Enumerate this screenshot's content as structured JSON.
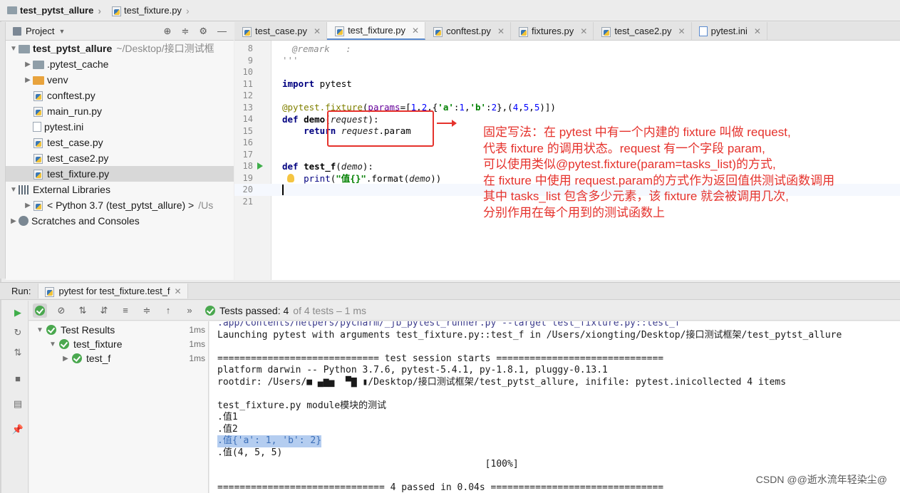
{
  "breadcrumb": {
    "project": "test_pytst_allure",
    "file": "test_fixture.py"
  },
  "project_panel": {
    "title": "Project",
    "tree": [
      {
        "label": "test_pytst_allure",
        "suffix": "~/Desktop/接口测试框",
        "icon": "folder-icon",
        "depth": 0,
        "expanded": true
      },
      {
        "label": ".pytest_cache",
        "icon": "folder-icon",
        "depth": 1,
        "expanded": false
      },
      {
        "label": "venv",
        "icon": "folder-orange-icon",
        "depth": 1,
        "expanded": false
      },
      {
        "label": "conftest.py",
        "icon": "python-file-icon",
        "depth": 1
      },
      {
        "label": "main_run.py",
        "icon": "python-file-icon",
        "depth": 1
      },
      {
        "label": "pytest.ini",
        "icon": "ini-file-icon",
        "depth": 1
      },
      {
        "label": "test_case.py",
        "icon": "python-file-icon",
        "depth": 1
      },
      {
        "label": "test_case2.py",
        "icon": "python-file-icon",
        "depth": 1
      },
      {
        "label": "test_fixture.py",
        "icon": "python-file-icon",
        "depth": 1,
        "selected": true
      },
      {
        "label": "External Libraries",
        "icon": "library-icon",
        "depth": 0,
        "expanded": true
      },
      {
        "label": "< Python 3.7 (test_pytst_allure) >",
        "suffix": "/Us",
        "icon": "python-sdk-icon",
        "depth": 1,
        "expanded": false
      },
      {
        "label": "Scratches and Consoles",
        "icon": "scratch-icon",
        "depth": 0,
        "expanded": false
      }
    ]
  },
  "editor_tabs": [
    {
      "label": "test_case.py",
      "icon": "python-file-icon",
      "active": false
    },
    {
      "label": "test_fixture.py",
      "icon": "python-file-icon",
      "active": true
    },
    {
      "label": "conftest.py",
      "icon": "python-file-icon",
      "active": false
    },
    {
      "label": "fixtures.py",
      "icon": "python-file-icon",
      "active": false
    },
    {
      "label": "test_case2.py",
      "icon": "python-file-icon",
      "active": false
    },
    {
      "label": "pytest.ini",
      "icon": "ini-file-icon",
      "active": false
    }
  ],
  "code": {
    "lines": [
      {
        "n": "8",
        "text": "@remark   :"
      },
      {
        "n": "9",
        "text": "'''"
      },
      {
        "n": "10",
        "text": ""
      },
      {
        "n": "11",
        "text": "import pytest"
      },
      {
        "n": "12",
        "text": ""
      },
      {
        "n": "13",
        "text": "@pytest.fixture(params=[1,2,{'a':1,'b':2},(4,5,5)])"
      },
      {
        "n": "14",
        "text": "def demo(request):"
      },
      {
        "n": "15",
        "text": "    return request.param"
      },
      {
        "n": "16",
        "text": ""
      },
      {
        "n": "17",
        "text": ""
      },
      {
        "n": "18",
        "text": "def test_f(demo):"
      },
      {
        "n": "19",
        "text": "    print(\"值{}\".format(demo))"
      },
      {
        "n": "20",
        "text": ""
      },
      {
        "n": "21",
        "text": ""
      }
    ],
    "current_line": "20"
  },
  "annotation": {
    "lines": [
      "固定写法：在 pytest 中有一个内建的 fixture 叫做 request,",
      "代表 fixture 的调用状态。request 有一个字段 param,",
      "可以使用类似@pytest.fixture(param=tasks_list)的方式,",
      "在 fixture 中使用 request.param的方式作为返回值供测试函数调用",
      "其中 tasks_list 包含多少元素，该 fixture 就会被调用几次,",
      "分别作用在每个用到的测试函数上"
    ],
    "color": "#e5322c"
  },
  "run_panel": {
    "label": "Run:",
    "tab": "pytest for test_fixture.test_f",
    "status_main": "Tests passed: 4",
    "status_detail": "of 4 tests – 1 ms",
    "results": [
      {
        "label": "Test Results",
        "duration": "1ms",
        "depth": 0
      },
      {
        "label": "test_fixture",
        "duration": "1ms",
        "depth": 1
      },
      {
        "label": "test_f",
        "duration": "1ms",
        "depth": 2
      }
    ]
  },
  "console": {
    "lines": [
      ".app/Contents/helpers/pycharm/_jb_pytest_runner.py --target test_fixture.py::test_f",
      "Launching pytest with arguments test_fixture.py::test_f in /Users/xiongting/Desktop/接口测试框架/test_pytst_allure",
      "",
      "============================= test session starts ==============================",
      "platform darwin -- Python 3.7.6, pytest-5.4.1, py-1.8.1, pluggy-0.13.1",
      "rootdir: /Users/■ ▄▆▅  ▀▇ ▮/Desktop/接口测试框架/test_pytst_allure, inifile: pytest.inicollected 4 items",
      "",
      "test_fixture.py module模块的测试",
      ".值1",
      ".值2",
      ".值{'a': 1, 'b': 2}",
      ".值(4, 5, 5)",
      "                                                [100%]",
      "",
      "============================== 4 passed in 0.04s ==============================="
    ],
    "selected_line": 10
  },
  "watermark": "CSDN @@逝水流年轻染尘@"
}
